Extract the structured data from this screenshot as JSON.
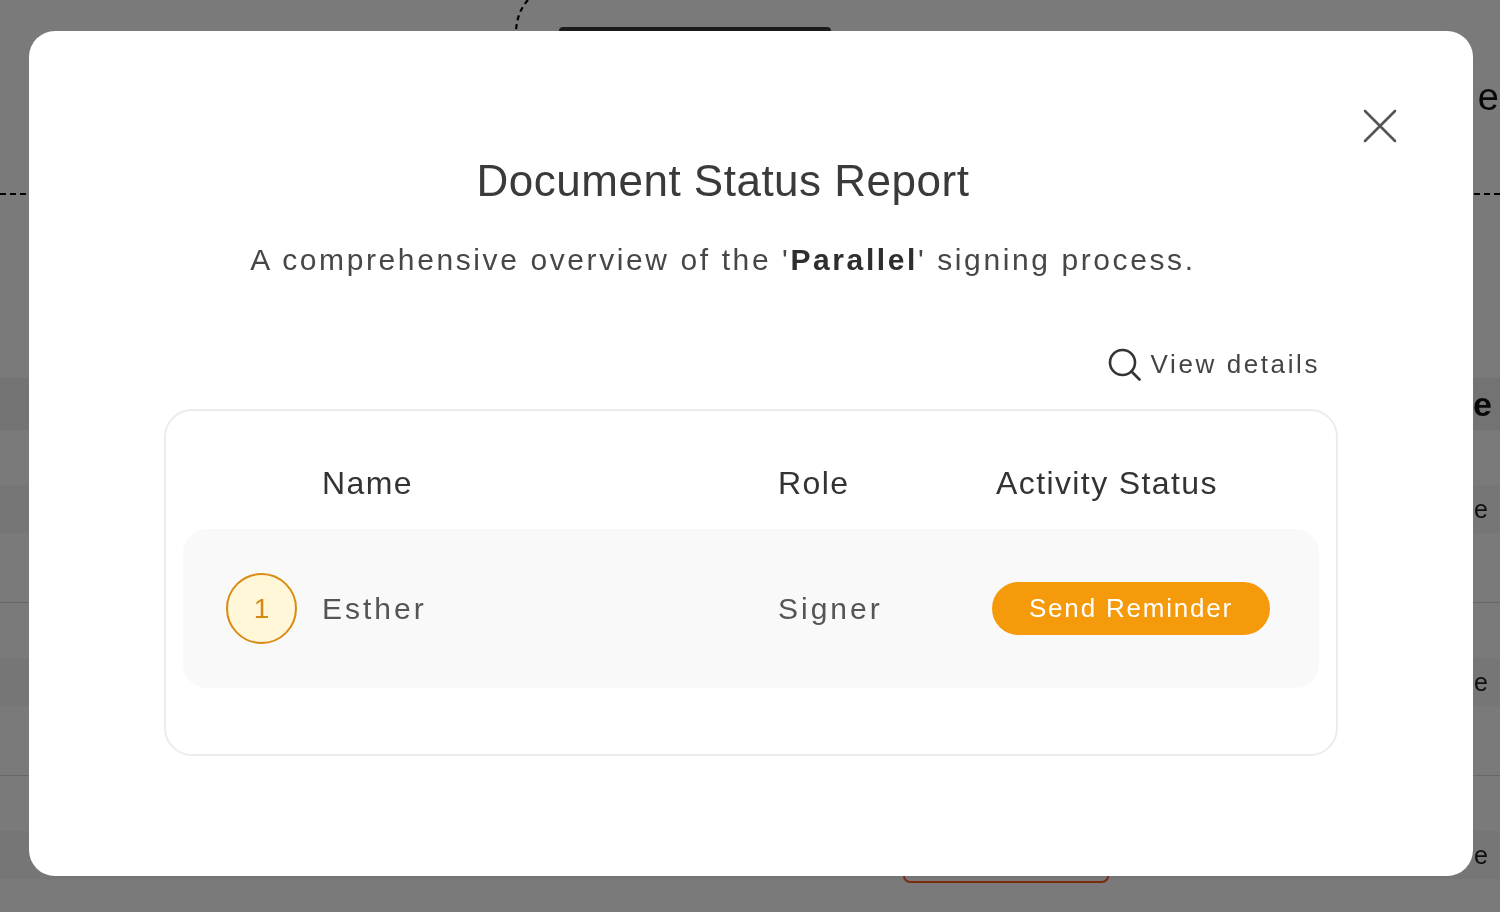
{
  "background_page": {
    "heading_fragment": "e",
    "section_fragment": "e",
    "row_fragments": [
      "e",
      "e",
      "e"
    ]
  },
  "dialog": {
    "title": "Document Status Report",
    "subtitle": "A comprehensive overview of the '**Parallel**' signing process.",
    "view_details": "View details",
    "table": {
      "columns": [
        "Name",
        "Role",
        "Activity Status"
      ],
      "rows": [
        {
          "number": "1",
          "name": "Esther",
          "role": "Signer",
          "action": "Send Reminder"
        }
      ]
    }
  }
}
